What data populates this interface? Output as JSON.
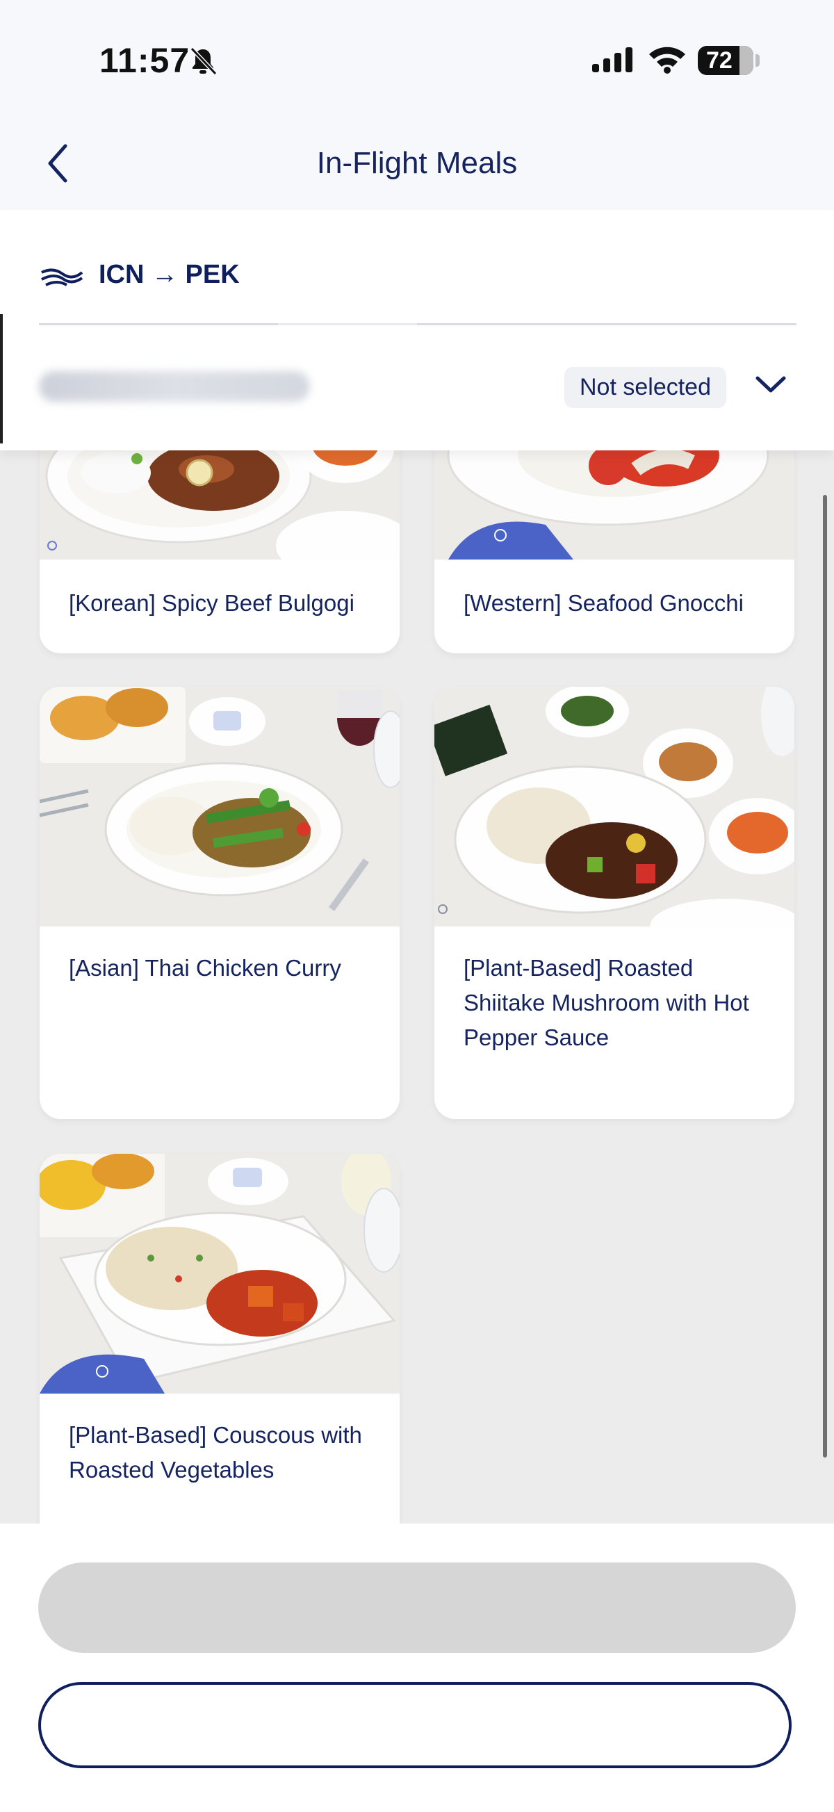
{
  "status_bar": {
    "time": "11:57",
    "battery": "72"
  },
  "header": {
    "title": "In-Flight Meals"
  },
  "route": {
    "text": "ICN → PEK"
  },
  "passenger": {
    "status": "Not selected"
  },
  "meals": [
    {
      "label": "[Korean] Spicy Beef Bulgogi"
    },
    {
      "label": "[Western] Seafood Gnocchi"
    },
    {
      "label": "[Asian] Thai Chicken Curry"
    },
    {
      "label": "[Plant-Based] Roasted Shiitake Mushroom with Hot Pepper Sauce"
    },
    {
      "label": "[Plant-Based] Couscous with Roasted Vegetables"
    }
  ],
  "colors": {
    "navy": "#0f1f5c",
    "disabled_button": "#d6d6d6",
    "background": "#ececec"
  },
  "icons": [
    "bell-slash-icon",
    "cellular-signal-icon",
    "wifi-icon",
    "battery-icon",
    "back-chevron-icon",
    "airline-logo-icon",
    "chevron-down-icon"
  ]
}
